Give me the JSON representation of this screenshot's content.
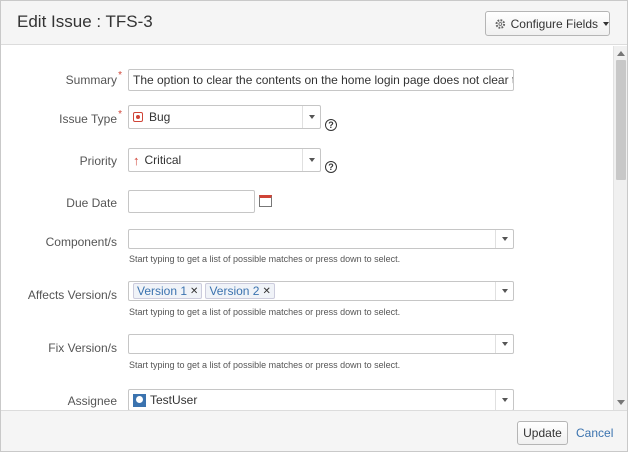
{
  "dialog": {
    "title": "Edit Issue : TFS-3",
    "configure_label": "Configure Fields"
  },
  "fields": {
    "summary": {
      "label": "Summary",
      "value": "The option to clear the contents on the home login page does not clear the fie"
    },
    "issue_type": {
      "label": "Issue Type",
      "value": "Bug"
    },
    "priority": {
      "label": "Priority",
      "value": "Critical"
    },
    "due_date": {
      "label": "Due Date",
      "value": ""
    },
    "components": {
      "label": "Component/s",
      "hint": "Start typing to get a list of possible matches or press down to select."
    },
    "affects_versions": {
      "label": "Affects Version/s",
      "tags": [
        "Version 1",
        "Version 2"
      ],
      "hint": "Start typing to get a list of possible matches or press down to select."
    },
    "fix_versions": {
      "label": "Fix Version/s",
      "hint": "Start typing to get a list of possible matches or press down to select."
    },
    "assignee": {
      "label": "Assignee",
      "value": "TestUser"
    }
  },
  "footer": {
    "update_label": "Update",
    "cancel_label": "Cancel"
  },
  "colors": {
    "link": "#3b73af",
    "required": "#d04437",
    "header_bg": "#f5f5f5"
  },
  "icons": [
    "gear-icon",
    "bug-icon",
    "priority-critical-icon",
    "calendar-icon",
    "user-avatar-icon",
    "help-icon"
  ]
}
